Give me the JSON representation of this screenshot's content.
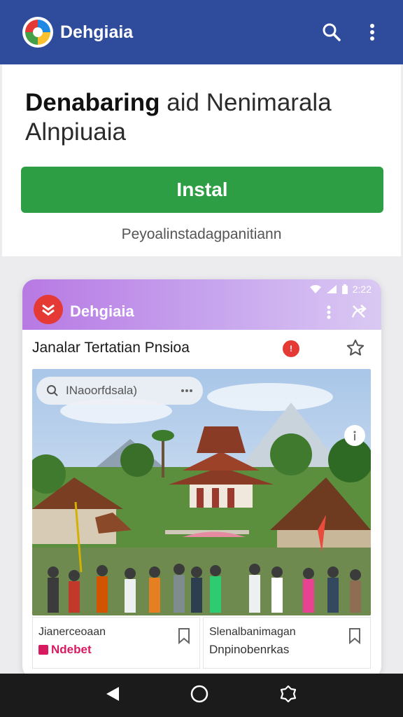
{
  "app": {
    "name": "Dehgiaia",
    "colors": {
      "appbar": "#2f4b9c",
      "install": "#2e9e44",
      "accent_red": "#e53935"
    }
  },
  "install_card": {
    "headline_bold": "Denabaring",
    "headline_rest": " aid Nenimarala Alnpiuaia",
    "install_label": "Instal",
    "subnote": "Peyoalinstadagpanitiann"
  },
  "preview": {
    "status_time": "2:22",
    "app_name": "Dehgiaia",
    "article_title": "Janalar Tertatian Pnsioa",
    "notif_badge": "!",
    "search_placeholder": "INaoorfdsala)",
    "tiles": [
      {
        "line1": "Jianerceoaan",
        "line2": "Ndebet"
      },
      {
        "line1": "Slenalbanimagan",
        "line2": "Dnpinobenrkas"
      }
    ]
  },
  "icons": {
    "search": "search-icon",
    "more": "more-vert-icon",
    "share": "share-icon",
    "star": "star-outline-icon",
    "bookmark": "bookmark-icon",
    "back": "nav-back-icon",
    "home": "nav-home-icon",
    "recents": "nav-recents-icon"
  }
}
